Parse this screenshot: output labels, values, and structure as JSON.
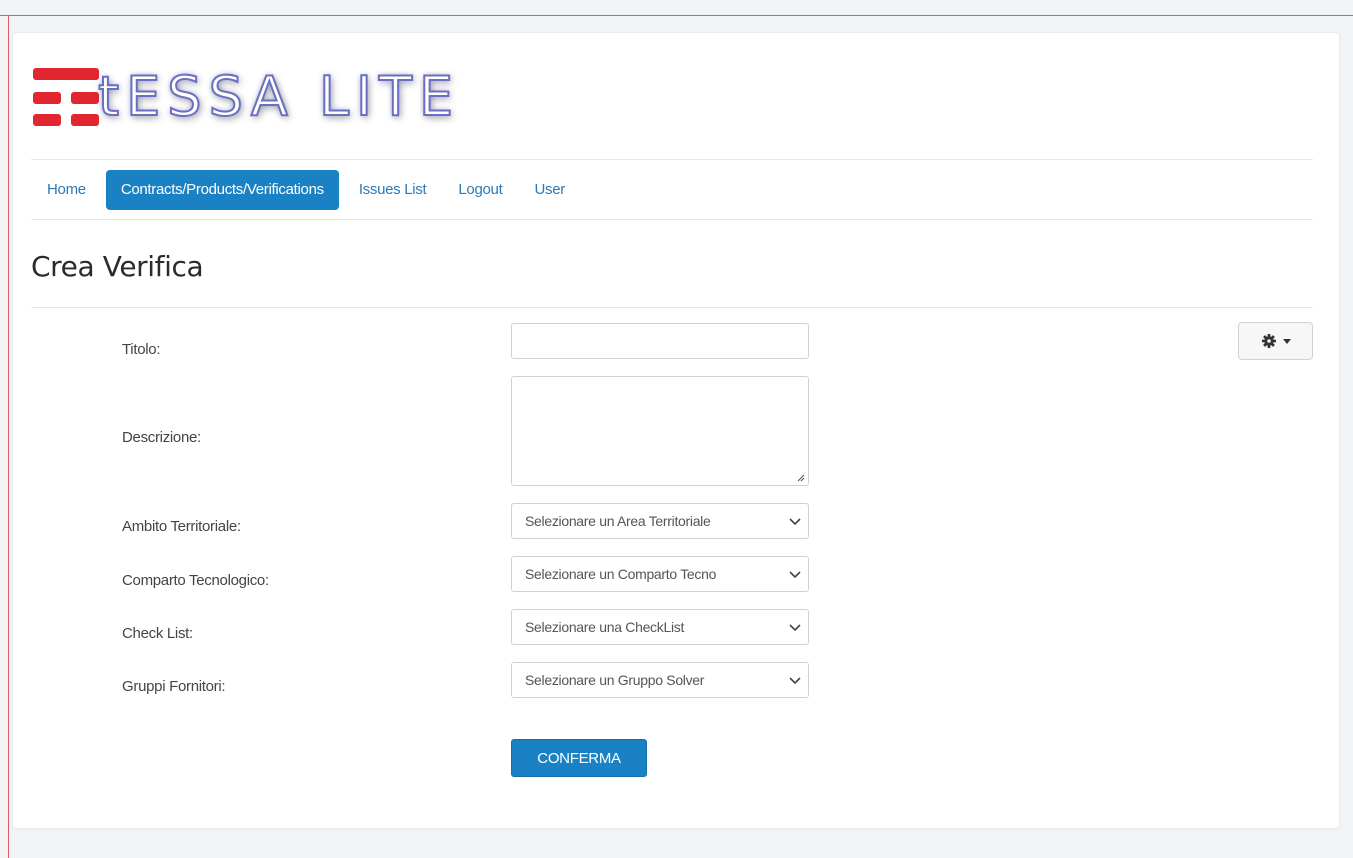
{
  "app": {
    "logo_text": "tESSA LITE"
  },
  "nav": {
    "items": [
      {
        "label": "Home",
        "active": false
      },
      {
        "label": "Contracts/Products/Verifications",
        "active": true
      },
      {
        "label": "Issues List",
        "active": false
      },
      {
        "label": "Logout",
        "active": false
      },
      {
        "label": "User",
        "active": false
      }
    ]
  },
  "page": {
    "title": "Crea Verifica"
  },
  "form": {
    "titolo_label": "Titolo:",
    "titolo_value": "",
    "descrizione_label": "Descrizione:",
    "descrizione_value": "",
    "ambito_label": "Ambito Territoriale:",
    "ambito_selected": "Selezionare un Area Territoriale",
    "comparto_label": "Comparto Tecnologico:",
    "comparto_selected": "Selezionare un Comparto Tecno",
    "checklist_label": "Check List:",
    "checklist_selected": "Selezionare una CheckList",
    "gruppi_label": "Gruppi Fornitori:",
    "gruppi_selected": "Selezionare un Gruppo Solver",
    "confirm_label": "CONFERMA"
  },
  "toolbar": {
    "settings_icon": "gear-icon",
    "dropdown_icon": "caret-down-icon"
  },
  "colors": {
    "brand_red": "#e2262f",
    "primary_blue": "#1a82c4",
    "link_blue": "#2a7ab8"
  }
}
